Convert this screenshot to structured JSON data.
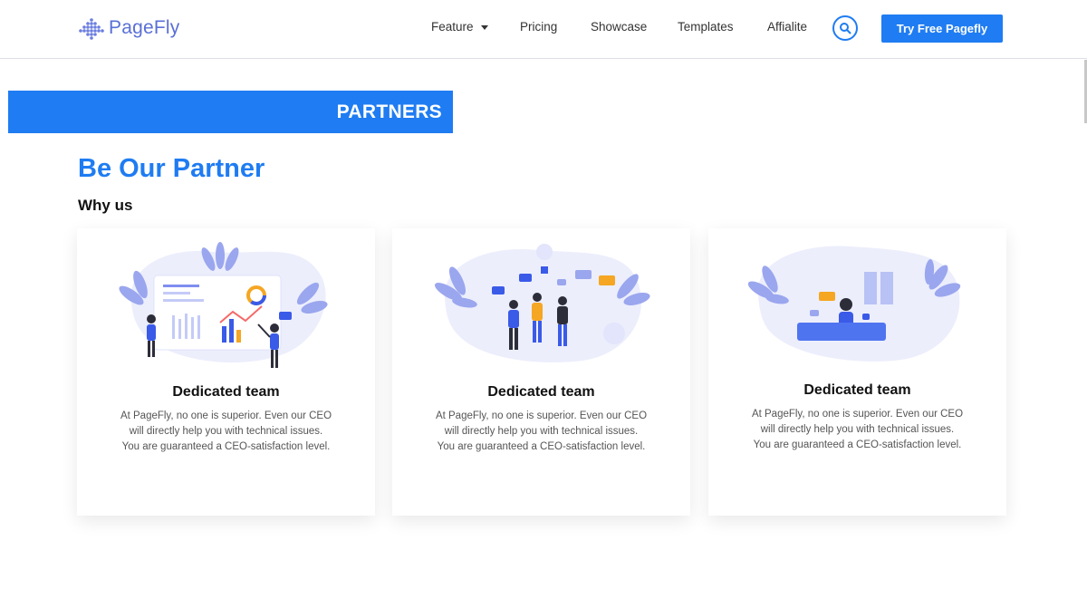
{
  "header": {
    "brand": "PageFly",
    "nav": [
      {
        "label": "Feature",
        "has_dropdown": true
      },
      {
        "label": "Pricing"
      },
      {
        "label": "Showcase"
      },
      {
        "label": "Templates"
      },
      {
        "label": "Affialite"
      }
    ],
    "search_icon": "search-icon",
    "cta_label": "Try Free Pagefly"
  },
  "banner": {
    "label": "PARTNERS"
  },
  "section": {
    "title": "Be Our Partner",
    "subtitle": "Why us"
  },
  "cards": [
    {
      "illustration": "dashboard-team-illustration",
      "title": "Dedicated team",
      "text_lines": [
        "At PageFly, no one is superior. Even our CEO",
        "will directly help you with technical issues.",
        "You are guaranteed a CEO-satisfaction level."
      ]
    },
    {
      "illustration": "team-chat-illustration",
      "title": "Dedicated team",
      "text_lines": [
        "At PageFly, no one is superior. Even our CEO",
        "will directly help you with technical issues.",
        "You are guaranteed a CEO-satisfaction level."
      ]
    },
    {
      "illustration": "support-desk-illustration",
      "title": "Dedicated team",
      "text_lines": [
        "At PageFly, no one is superior. Even our CEO",
        "will directly help you with technical issues.",
        "You are guaranteed a CEO-satisfaction level."
      ]
    }
  ],
  "colors": {
    "accent": "#1f7cf2",
    "brand_logo": "#5a6fd6",
    "illustration_blob": "#eceefc",
    "illustration_leaf": "#9aa6ee"
  }
}
